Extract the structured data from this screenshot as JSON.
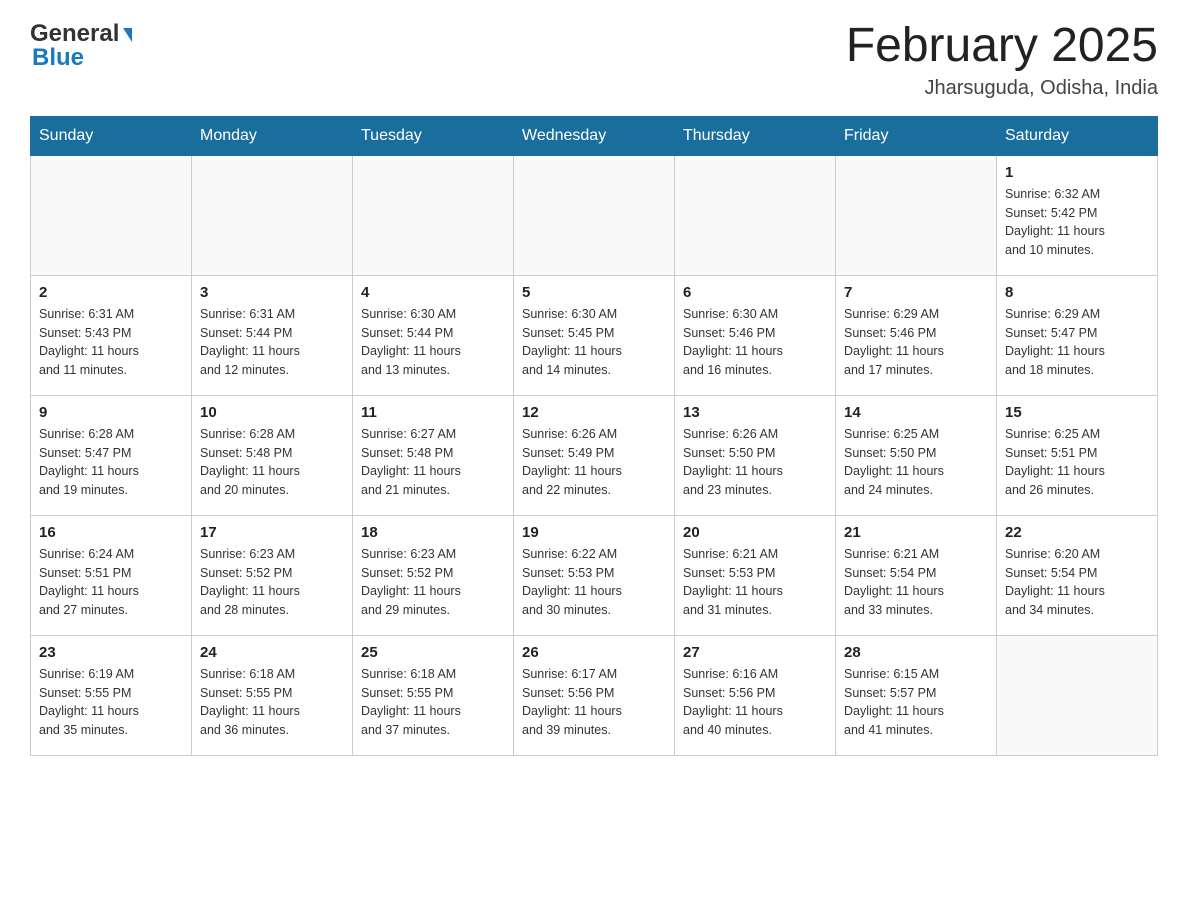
{
  "header": {
    "logo_line1": "General",
    "logo_line2": "Blue",
    "month_title": "February 2025",
    "location": "Jharsuguda, Odisha, India"
  },
  "calendar": {
    "days_of_week": [
      "Sunday",
      "Monday",
      "Tuesday",
      "Wednesday",
      "Thursday",
      "Friday",
      "Saturday"
    ],
    "weeks": [
      [
        {
          "day": "",
          "info": ""
        },
        {
          "day": "",
          "info": ""
        },
        {
          "day": "",
          "info": ""
        },
        {
          "day": "",
          "info": ""
        },
        {
          "day": "",
          "info": ""
        },
        {
          "day": "",
          "info": ""
        },
        {
          "day": "1",
          "info": "Sunrise: 6:32 AM\nSunset: 5:42 PM\nDaylight: 11 hours\nand 10 minutes."
        }
      ],
      [
        {
          "day": "2",
          "info": "Sunrise: 6:31 AM\nSunset: 5:43 PM\nDaylight: 11 hours\nand 11 minutes."
        },
        {
          "day": "3",
          "info": "Sunrise: 6:31 AM\nSunset: 5:44 PM\nDaylight: 11 hours\nand 12 minutes."
        },
        {
          "day": "4",
          "info": "Sunrise: 6:30 AM\nSunset: 5:44 PM\nDaylight: 11 hours\nand 13 minutes."
        },
        {
          "day": "5",
          "info": "Sunrise: 6:30 AM\nSunset: 5:45 PM\nDaylight: 11 hours\nand 14 minutes."
        },
        {
          "day": "6",
          "info": "Sunrise: 6:30 AM\nSunset: 5:46 PM\nDaylight: 11 hours\nand 16 minutes."
        },
        {
          "day": "7",
          "info": "Sunrise: 6:29 AM\nSunset: 5:46 PM\nDaylight: 11 hours\nand 17 minutes."
        },
        {
          "day": "8",
          "info": "Sunrise: 6:29 AM\nSunset: 5:47 PM\nDaylight: 11 hours\nand 18 minutes."
        }
      ],
      [
        {
          "day": "9",
          "info": "Sunrise: 6:28 AM\nSunset: 5:47 PM\nDaylight: 11 hours\nand 19 minutes."
        },
        {
          "day": "10",
          "info": "Sunrise: 6:28 AM\nSunset: 5:48 PM\nDaylight: 11 hours\nand 20 minutes."
        },
        {
          "day": "11",
          "info": "Sunrise: 6:27 AM\nSunset: 5:48 PM\nDaylight: 11 hours\nand 21 minutes."
        },
        {
          "day": "12",
          "info": "Sunrise: 6:26 AM\nSunset: 5:49 PM\nDaylight: 11 hours\nand 22 minutes."
        },
        {
          "day": "13",
          "info": "Sunrise: 6:26 AM\nSunset: 5:50 PM\nDaylight: 11 hours\nand 23 minutes."
        },
        {
          "day": "14",
          "info": "Sunrise: 6:25 AM\nSunset: 5:50 PM\nDaylight: 11 hours\nand 24 minutes."
        },
        {
          "day": "15",
          "info": "Sunrise: 6:25 AM\nSunset: 5:51 PM\nDaylight: 11 hours\nand 26 minutes."
        }
      ],
      [
        {
          "day": "16",
          "info": "Sunrise: 6:24 AM\nSunset: 5:51 PM\nDaylight: 11 hours\nand 27 minutes."
        },
        {
          "day": "17",
          "info": "Sunrise: 6:23 AM\nSunset: 5:52 PM\nDaylight: 11 hours\nand 28 minutes."
        },
        {
          "day": "18",
          "info": "Sunrise: 6:23 AM\nSunset: 5:52 PM\nDaylight: 11 hours\nand 29 minutes."
        },
        {
          "day": "19",
          "info": "Sunrise: 6:22 AM\nSunset: 5:53 PM\nDaylight: 11 hours\nand 30 minutes."
        },
        {
          "day": "20",
          "info": "Sunrise: 6:21 AM\nSunset: 5:53 PM\nDaylight: 11 hours\nand 31 minutes."
        },
        {
          "day": "21",
          "info": "Sunrise: 6:21 AM\nSunset: 5:54 PM\nDaylight: 11 hours\nand 33 minutes."
        },
        {
          "day": "22",
          "info": "Sunrise: 6:20 AM\nSunset: 5:54 PM\nDaylight: 11 hours\nand 34 minutes."
        }
      ],
      [
        {
          "day": "23",
          "info": "Sunrise: 6:19 AM\nSunset: 5:55 PM\nDaylight: 11 hours\nand 35 minutes."
        },
        {
          "day": "24",
          "info": "Sunrise: 6:18 AM\nSunset: 5:55 PM\nDaylight: 11 hours\nand 36 minutes."
        },
        {
          "day": "25",
          "info": "Sunrise: 6:18 AM\nSunset: 5:55 PM\nDaylight: 11 hours\nand 37 minutes."
        },
        {
          "day": "26",
          "info": "Sunrise: 6:17 AM\nSunset: 5:56 PM\nDaylight: 11 hours\nand 39 minutes."
        },
        {
          "day": "27",
          "info": "Sunrise: 6:16 AM\nSunset: 5:56 PM\nDaylight: 11 hours\nand 40 minutes."
        },
        {
          "day": "28",
          "info": "Sunrise: 6:15 AM\nSunset: 5:57 PM\nDaylight: 11 hours\nand 41 minutes."
        },
        {
          "day": "",
          "info": ""
        }
      ]
    ]
  }
}
